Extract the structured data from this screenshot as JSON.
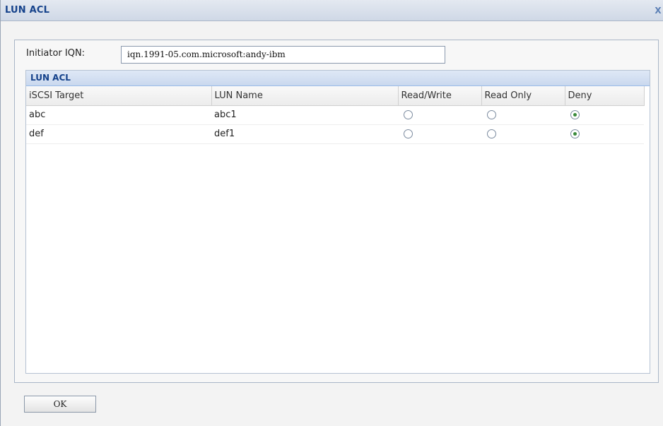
{
  "window": {
    "title": "LUN ACL",
    "close_glyph": "X"
  },
  "form": {
    "iqn_label": "Initiator IQN:",
    "iqn_value": "iqn.1991-05.com.microsoft:andy-ibm"
  },
  "grid": {
    "title": "LUN ACL",
    "columns": [
      "iSCSI Target",
      "LUN Name",
      "Read/Write",
      "Read Only",
      "Deny"
    ],
    "rows": [
      {
        "target": "abc",
        "lun": "abc1",
        "access": "Deny"
      },
      {
        "target": "def",
        "lun": "def1",
        "access": "Deny"
      }
    ]
  },
  "buttons": {
    "ok_label": "OK"
  },
  "colors": {
    "title_text": "#15428b",
    "selected_radio": "#3a8a3a"
  }
}
